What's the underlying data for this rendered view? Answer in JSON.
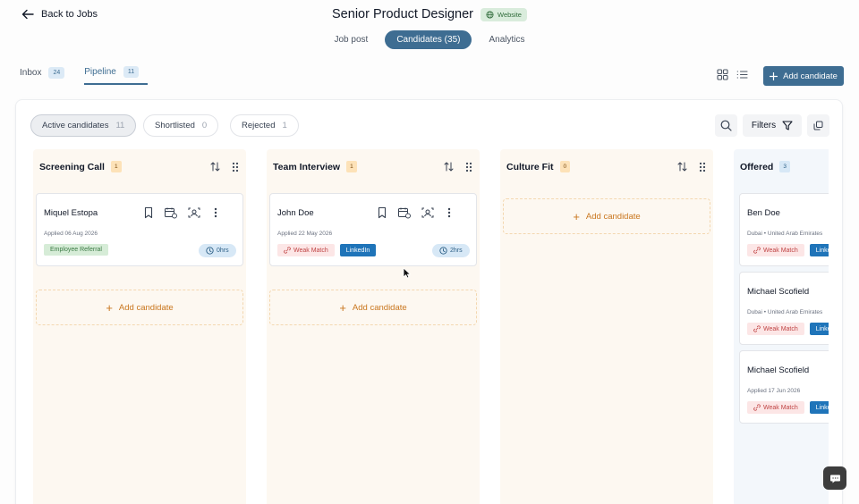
{
  "header": {
    "back_label": "Back to Jobs",
    "job_title": "Senior Product Designer",
    "source_badge": "Website",
    "tabs": [
      {
        "label": "Job post"
      },
      {
        "label": "Candidates (35)"
      },
      {
        "label": "Analytics"
      }
    ]
  },
  "subtabs": [
    {
      "label": "Inbox",
      "count": "24"
    },
    {
      "label": "Pipeline",
      "count": "11"
    }
  ],
  "toolbar": {
    "add_candidate_label": "Add candidate"
  },
  "filters": {
    "chips": [
      {
        "label": "Active candidates",
        "count": "11"
      },
      {
        "label": "Shortlisted",
        "count": "0"
      },
      {
        "label": "Rejected",
        "count": "1"
      }
    ],
    "filters_label": "Filters"
  },
  "columns": [
    {
      "title": "Screening Call",
      "count": "1",
      "add_label": "Add candidate",
      "cards": [
        {
          "name": "Miquel Estopa",
          "meta": "Applied 06 Aug 2026",
          "tag": "Employee Referral",
          "time": "0hrs"
        }
      ]
    },
    {
      "title": "Team Interview",
      "count": "1",
      "add_label": "Add candidate",
      "cards": [
        {
          "name": "John Doe",
          "meta": "Applied 22 May 2026",
          "tag": "Weak Match",
          "source": "LinkedIn",
          "time": "2hrs"
        }
      ]
    },
    {
      "title": "Culture Fit",
      "count": "0",
      "add_label": "Add candidate",
      "cards": []
    },
    {
      "title": "Offered",
      "count": "3",
      "cards": [
        {
          "name": "Ben Doe",
          "meta": "Dubai • United Arab Emirates",
          "tag": "Weak Match",
          "source": "LinkedIn"
        },
        {
          "name": "Michael Scofield",
          "meta": "Dubai • United Arab Emirates",
          "tag": "Weak Match",
          "source": "LinkedIn"
        },
        {
          "name": "Michael Scofield",
          "meta": "Applied 17 Jun 2026",
          "tag": "Weak Match",
          "source": "LinkedIn"
        }
      ]
    }
  ],
  "colors": {
    "primary": "#3e6d92",
    "add_accent": "#c9761e",
    "column_bg": "#fdf8f1",
    "offered_bg": "#f3f7fb",
    "linkedin": "#1f74b9"
  },
  "icons": [
    "arrow-left-icon",
    "globe-icon",
    "grid-view-icon",
    "list-view-icon",
    "plus-icon",
    "search-icon",
    "filter-icon",
    "collapse-icon",
    "sort-icon",
    "drag-handle-icon",
    "bookmark-icon",
    "calendar-icon",
    "scan-icon",
    "more-vertical-icon",
    "clock-icon",
    "broken-link-icon",
    "chat-icon"
  ]
}
